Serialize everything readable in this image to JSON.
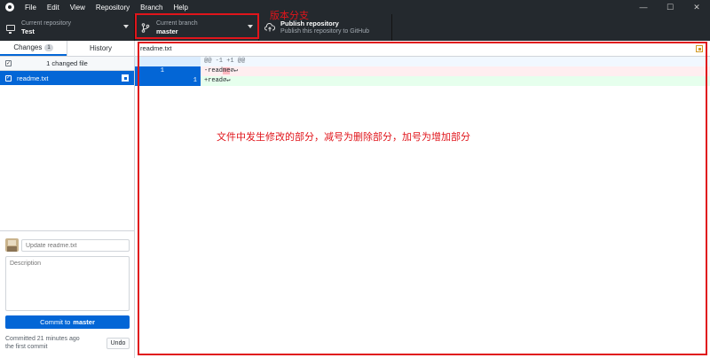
{
  "menu": [
    "File",
    "Edit",
    "View",
    "Repository",
    "Branch",
    "Help"
  ],
  "toolbar": {
    "repo": {
      "sub": "Current repository",
      "name": "Test"
    },
    "branch": {
      "sub": "Current branch",
      "name": "master"
    },
    "publish": {
      "title": "Publish repository",
      "sub": "Publish this repository to GitHub"
    }
  },
  "sidebar": {
    "tab_changes": "Changes",
    "tab_changes_count": "1",
    "tab_history": "History",
    "changed_files_label": "1 changed file",
    "files": [
      {
        "name": "readme.txt"
      }
    ]
  },
  "commit": {
    "summary_placeholder": "Update readme.txt",
    "description_placeholder": "Description",
    "button_prefix": "Commit to",
    "button_branch": "master",
    "last_commit_line1": "Committed 21 minutes ago",
    "last_commit_line2": "the first commit",
    "undo_label": "Undo"
  },
  "diff": {
    "filename": "readme.txt",
    "hunk": "@@ -1 +1 @@",
    "del_old_no": "1",
    "del_prefix": "-read",
    "del_highlight": "me",
    "del_suffix": "∅↵",
    "add_new_no": "1",
    "add_prefix": "+read",
    "add_suffix": "∅↵"
  },
  "annotations": {
    "branch": "版本分支",
    "diff": "文件中发生修改的部分，减号为删除部分，加号为增加部分"
  },
  "colors": {
    "accent": "#0366d6",
    "annotation": "#e0151b",
    "toolbar_bg": "#24292e"
  }
}
